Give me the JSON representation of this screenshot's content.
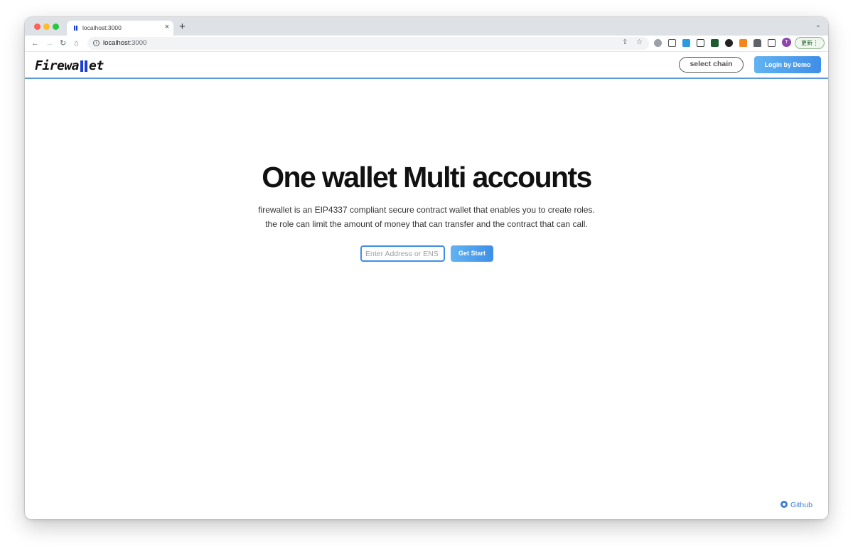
{
  "browser": {
    "tab_title": "localhost:3000",
    "tab_close": "×",
    "new_tab": "+",
    "tab_menu": "⌄",
    "url_host": "localhost",
    "url_port": ":3000",
    "update_label": "更新",
    "profile_initial": "T"
  },
  "header": {
    "logo_prefix": "Firewa",
    "logo_suffix": "et",
    "select_chain": "select chain",
    "login_demo": "Login by Demo"
  },
  "hero": {
    "title": "One wallet Multi accounts",
    "description": "firewallet is an EIP4337 compliant secure contract wallet that enables you to create roles. the role can limit the amount of money that can transfer and the contract that can call.",
    "input_placeholder": "Enter Address or ENS",
    "input_value": "",
    "cta": "Get Start"
  },
  "footer": {
    "github": "Github"
  },
  "colors": {
    "accent": "#3f8ee8",
    "accent_light": "#62b3f1",
    "logo_bar": "#1a3fd1",
    "link": "#3f7fd6"
  }
}
